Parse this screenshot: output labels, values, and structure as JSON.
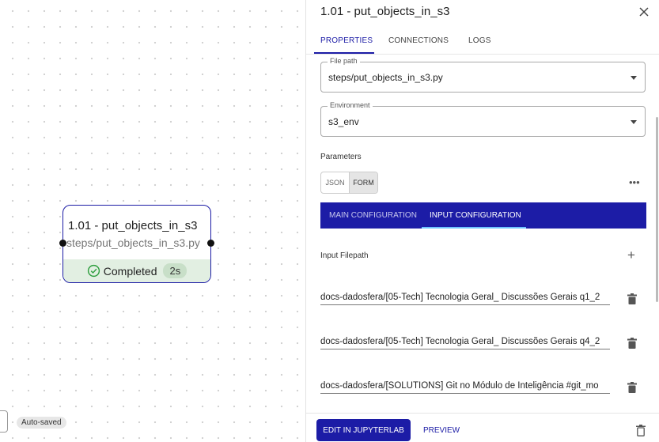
{
  "canvas": {
    "node": {
      "title": "1.01 - put_objects_in_s3",
      "path": "steps/put_objects_in_s3.py",
      "status": "Completed",
      "duration": "2s"
    },
    "autosaved_label": "Auto-saved"
  },
  "panel": {
    "title": "1.01 - put_objects_in_s3",
    "tabs": [
      {
        "label": "PROPERTIES",
        "active": true
      },
      {
        "label": "CONNECTIONS",
        "active": false
      },
      {
        "label": "LOGS",
        "active": false
      }
    ],
    "file_path": {
      "label": "File path",
      "value": "steps/put_objects_in_s3.py"
    },
    "environment": {
      "label": "Environment",
      "value": "s3_env"
    },
    "parameters_label": "Parameters",
    "mode_toggle": {
      "json": "JSON",
      "form": "FORM",
      "selected": "FORM"
    },
    "more_label": "•••",
    "config_tabs": [
      {
        "label": "MAIN CONFIGURATION",
        "active": false
      },
      {
        "label": "INPUT CONFIGURATION",
        "active": true
      }
    ],
    "input_filepath_label": "Input Filepath",
    "add_label": "+",
    "input_files": [
      "docs-dadosfera/[05-Tech] Tecnologia Geral_ Discussões Gerais q1_2",
      "docs-dadosfera/[05-Tech] Tecnologia Geral_ Discussões Gerais q4_2",
      "docs-dadosfera/[SOLUTIONS] Git no Módulo de Inteligência #git_mo"
    ],
    "footer": {
      "edit_label": "EDIT IN JUPYTERLAB",
      "preview_label": "PREVIEW"
    }
  },
  "colors": {
    "accent": "#1c1ca6",
    "completed_bg": "#e2efe2",
    "success": "#2e9e3e"
  }
}
